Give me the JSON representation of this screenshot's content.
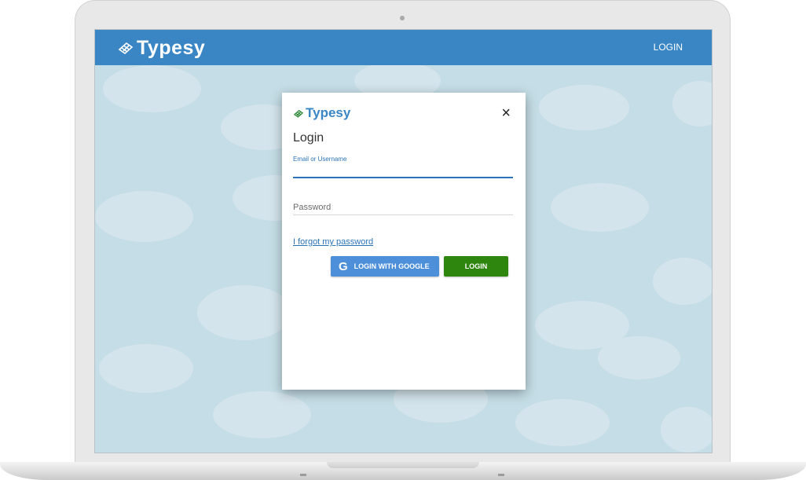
{
  "header": {
    "brand": "Typesy",
    "login_label": "LOGIN"
  },
  "modal": {
    "brand": "Typesy",
    "close_symbol": "×",
    "title": "Login",
    "email_label": "Email or Username",
    "email_value": "",
    "password_placeholder": "Password",
    "forgot_link": "I forgot my password",
    "google_button": "LOGIN WITH GOOGLE",
    "google_icon": "G",
    "login_button": "LOGIN"
  },
  "colors": {
    "topbar": "#3a86c4",
    "google_button": "#4d8fd9",
    "login_button": "#2f860f",
    "link": "#2b74b8",
    "background": "#c5dde6"
  },
  "icons": [
    "keyboard-logo-icon",
    "close-icon",
    "google-g-icon"
  ]
}
